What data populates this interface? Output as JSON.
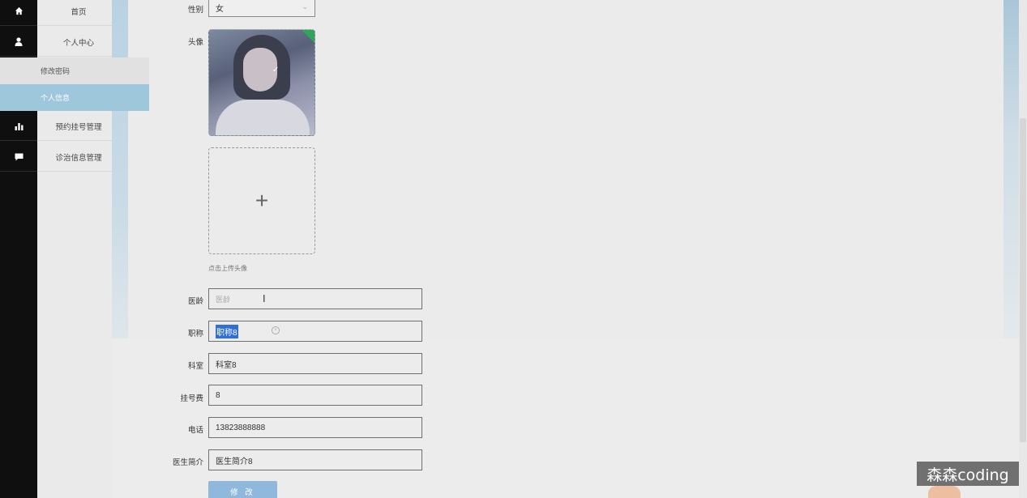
{
  "rail": {
    "icons": [
      "home-icon",
      "user-icon",
      "bar-chart-icon",
      "chat-icon"
    ]
  },
  "menu": {
    "home": "首页",
    "personal_center": "个人中心",
    "change_password": "修改密码",
    "personal_info": "个人信息",
    "appointment_mgmt": "预约挂号管理",
    "treatment_mgmt": "诊治信息管理"
  },
  "form": {
    "gender_label": "性别",
    "gender_value": "女",
    "avatar_label": "头像",
    "upload_tip": "点击上传头像",
    "experience_label": "医龄",
    "experience_placeholder": "医龄",
    "title_label": "职称",
    "title_value": "职称8",
    "department_label": "科室",
    "department_value": "科室8",
    "fee_label": "挂号费",
    "fee_value": "8",
    "phone_label": "电话",
    "phone_value": "13823888888",
    "intro_label": "医生简介",
    "intro_value": "医生简介8",
    "submit_label": "修 改"
  },
  "watermark": "森森coding",
  "colors": {
    "rail_bg": "#0f0f0f",
    "active_menu": "#9fc7db",
    "button": "#8fb8dc",
    "avatar_badge": "#2ea55a"
  }
}
